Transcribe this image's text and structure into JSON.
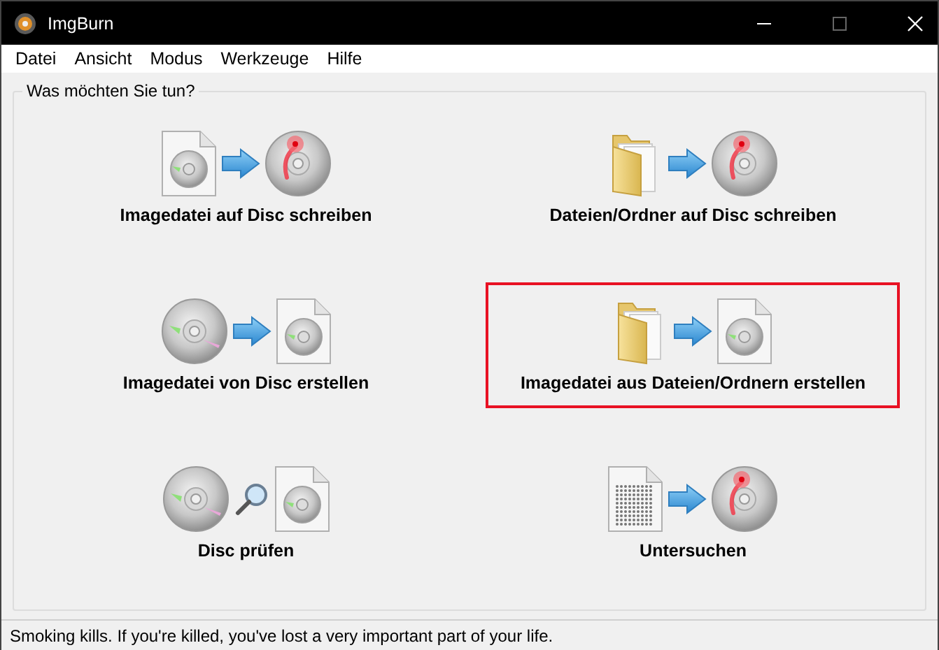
{
  "window": {
    "title": "ImgBurn"
  },
  "menu": [
    "Datei",
    "Ansicht",
    "Modus",
    "Werkzeuge",
    "Hilfe"
  ],
  "group": {
    "title": "Was möchten Sie tun?",
    "tasks": [
      {
        "label": "Imagedatei auf Disc schreiben",
        "icons": [
          {
            "kind": "image-file"
          },
          {
            "kind": "arrow"
          },
          {
            "kind": "burn-disc"
          }
        ],
        "selected": false
      },
      {
        "label": "Dateien/Ordner auf Disc schreiben",
        "icons": [
          {
            "kind": "folder"
          },
          {
            "kind": "arrow"
          },
          {
            "kind": "burn-disc"
          }
        ],
        "selected": false
      },
      {
        "label": "Imagedatei von Disc erstellen",
        "icons": [
          {
            "kind": "disc"
          },
          {
            "kind": "arrow"
          },
          {
            "kind": "image-file"
          }
        ],
        "selected": false
      },
      {
        "label": "Imagedatei aus Dateien/Ordnern erstellen",
        "icons": [
          {
            "kind": "folder"
          },
          {
            "kind": "arrow"
          },
          {
            "kind": "image-file"
          }
        ],
        "selected": true
      },
      {
        "label": "Disc prüfen",
        "icons": [
          {
            "kind": "disc"
          },
          {
            "kind": "magnifier"
          },
          {
            "kind": "image-file"
          }
        ],
        "selected": false
      },
      {
        "label": "Untersuchen",
        "icons": [
          {
            "kind": "data-sheet"
          },
          {
            "kind": "arrow"
          },
          {
            "kind": "burn-disc"
          }
        ],
        "selected": false
      }
    ]
  },
  "status_bar": "Smoking kills. If you're killed, you've lost a very important part of your life."
}
